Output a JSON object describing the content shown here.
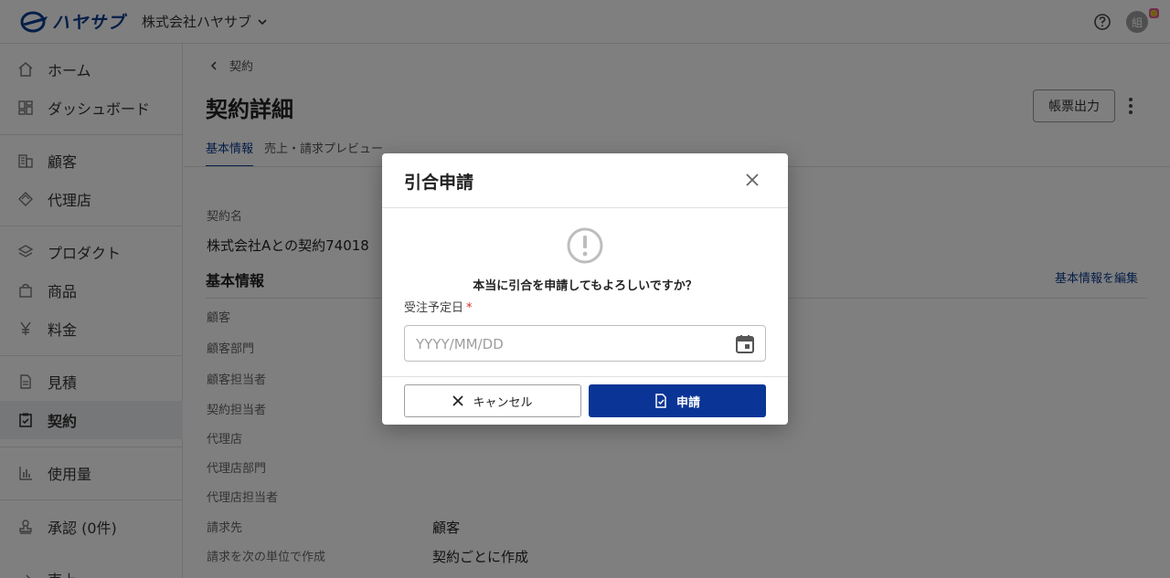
{
  "header": {
    "logo_text": "ハヤサブ",
    "company_name": "株式会社ハヤサブ",
    "avatar_initial": "組",
    "avatar_badge": "🙂"
  },
  "sidebar": {
    "items": [
      {
        "label": "ホーム",
        "icon": "home-icon"
      },
      {
        "label": "ダッシュボード",
        "icon": "dashboard-icon"
      },
      {
        "label": "顧客",
        "icon": "building-icon"
      },
      {
        "label": "代理店",
        "icon": "handshake-icon"
      },
      {
        "label": "プロダクト",
        "icon": "layers-icon"
      },
      {
        "label": "商品",
        "icon": "shopping-bag-icon"
      },
      {
        "label": "料金",
        "icon": "yen-icon"
      },
      {
        "label": "見積",
        "icon": "document-icon"
      },
      {
        "label": "契約",
        "icon": "clipboard-check-icon"
      },
      {
        "label": "使用量",
        "icon": "bar-chart-icon"
      },
      {
        "label": "承認 (0件)",
        "icon": "stamp-icon"
      },
      {
        "label": "売上",
        "icon": "arrow-icon"
      }
    ]
  },
  "main": {
    "breadcrumb": "契約",
    "title": "契約詳細",
    "export_label": "帳票出力",
    "tabs": [
      {
        "label": "基本情報"
      },
      {
        "label": "売上・請求プレビュー"
      }
    ],
    "contract_name_label": "契約名",
    "contract_name_value": "株式会社Aとの契約74018",
    "section_title": "基本情報",
    "edit_link": "基本情報を編集",
    "fields": [
      {
        "label": "顧客",
        "value": ""
      },
      {
        "label": "顧客部門",
        "value": ""
      },
      {
        "label": "顧客担当者",
        "value": ""
      },
      {
        "label": "契約担当者",
        "value": ""
      },
      {
        "label": "代理店",
        "value": ""
      },
      {
        "label": "代理店部門",
        "value": ""
      },
      {
        "label": "代理店担当者",
        "value": ""
      },
      {
        "label": "請求先",
        "value": "顧客"
      },
      {
        "label": "請求を次の単位で作成",
        "value": "契約ごとに作成"
      }
    ]
  },
  "modal": {
    "title": "引合申請",
    "confirm_text": "本当に引合を申請してもよろしいですか？",
    "date_label": "受注予定日",
    "required_mark": "*",
    "date_placeholder": "YYYY/MM/DD",
    "date_value": "",
    "cancel_label": "キャンセル",
    "apply_label": "申請"
  },
  "colors": {
    "brand": "#0a3d91",
    "primary_button": "#0a3596",
    "required": "#d32f2f"
  }
}
